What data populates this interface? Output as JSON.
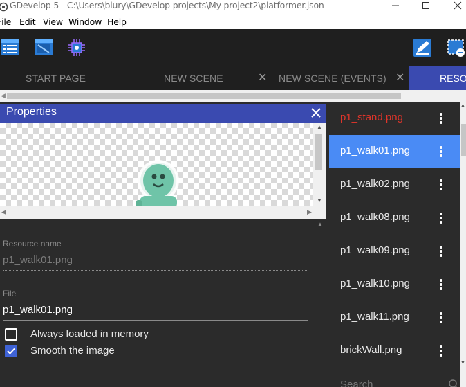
{
  "window": {
    "title": "GDevelop 5 - C:\\Users\\blury\\GDevelop projects\\My project2\\platformer.json"
  },
  "menu": [
    "File",
    "Edit",
    "View",
    "Window",
    "Help"
  ],
  "toolbar": {
    "buttons": [
      "project-manager-icon",
      "scene-editor-icon",
      "debugger-icon",
      "edit-object-icon",
      "instances-icon"
    ]
  },
  "tabs": [
    {
      "label": "START PAGE",
      "closable": false
    },
    {
      "label": "NEW SCENE",
      "closable": true
    },
    {
      "label": "NEW SCENE (EVENTS)",
      "closable": true
    },
    {
      "label": "RESO",
      "closable": false,
      "active": true
    }
  ],
  "properties": {
    "title": "Properties",
    "resource_name_label": "Resource name",
    "resource_name_value": "p1_walk01.png",
    "file_label": "File",
    "file_value": "p1_walk01.png",
    "always_loaded": {
      "label": "Always loaded in memory",
      "checked": false
    },
    "smooth_image": {
      "label": "Smooth the image",
      "checked": true
    }
  },
  "resources": {
    "items": [
      "p1_stand.png",
      "p1_walk01.png",
      "p1_walk02.png",
      "p1_walk08.png",
      "p1_walk09.png",
      "p1_walk10.png",
      "p1_walk11.png",
      "brickWall.png"
    ],
    "selected_index": 1,
    "search_placeholder": "Search"
  },
  "colors": {
    "accent": "#3a4ab0",
    "selected": "#4a8bf5",
    "error_text": "#e0352b",
    "panel": "#2b2b2b",
    "toolbar": "#1f1f1f"
  }
}
